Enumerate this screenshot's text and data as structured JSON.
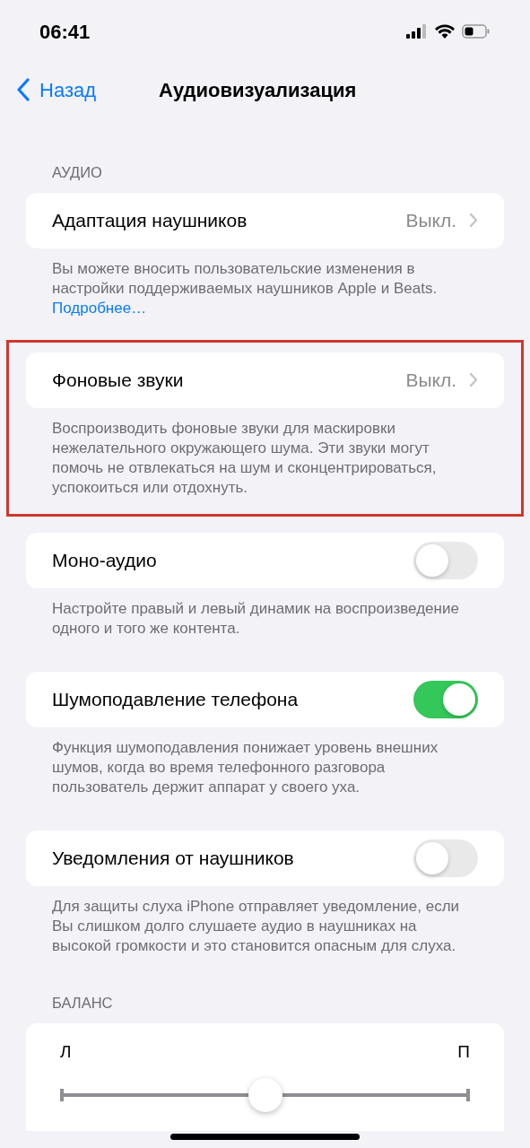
{
  "status_bar": {
    "time": "06:41"
  },
  "nav": {
    "back": "Назад",
    "title": "Аудиовизуализация"
  },
  "section_header": "АУДИО",
  "sections": [
    {
      "kind": "nav",
      "label": "Адаптация наушников",
      "value": "Выкл.",
      "footer": "Вы можете вносить пользовательские изменения в настройки поддерживаемых наушников Apple и Beats.",
      "footer_link": "Подробнее…",
      "highlighted": false
    },
    {
      "kind": "nav",
      "label": "Фоновые звуки",
      "value": "Выкл.",
      "footer": "Воспроизводить фоновые звуки для маскировки нежелательного окружающего шума. Эти звуки могут помочь не отвлекаться на шум и сконцентрироваться, успокоиться или отдохнуть.",
      "highlighted": true
    },
    {
      "kind": "toggle",
      "label": "Моно-аудио",
      "on": false,
      "footer": "Настройте правый и левый динамик на воспроизведение одного и того же контента.",
      "highlighted": false
    },
    {
      "kind": "toggle",
      "label": "Шумоподавление телефона",
      "on": true,
      "footer": "Функция шумоподавления понижает уровень внешних шумов, когда во время телефонного разговора пользователь держит аппарат у своего уха.",
      "highlighted": false
    },
    {
      "kind": "toggle",
      "label": "Уведомления от наушников",
      "on": false,
      "footer": "Для защиты слуха iPhone отправляет уведомление, если Вы слишком долго слушаете аудио в наушниках на высокой громкости и это становится опасным для слуха.",
      "highlighted": false
    }
  ],
  "balance": {
    "header": "БАЛАНС",
    "left": "Л",
    "right": "П",
    "level": 0.5
  }
}
